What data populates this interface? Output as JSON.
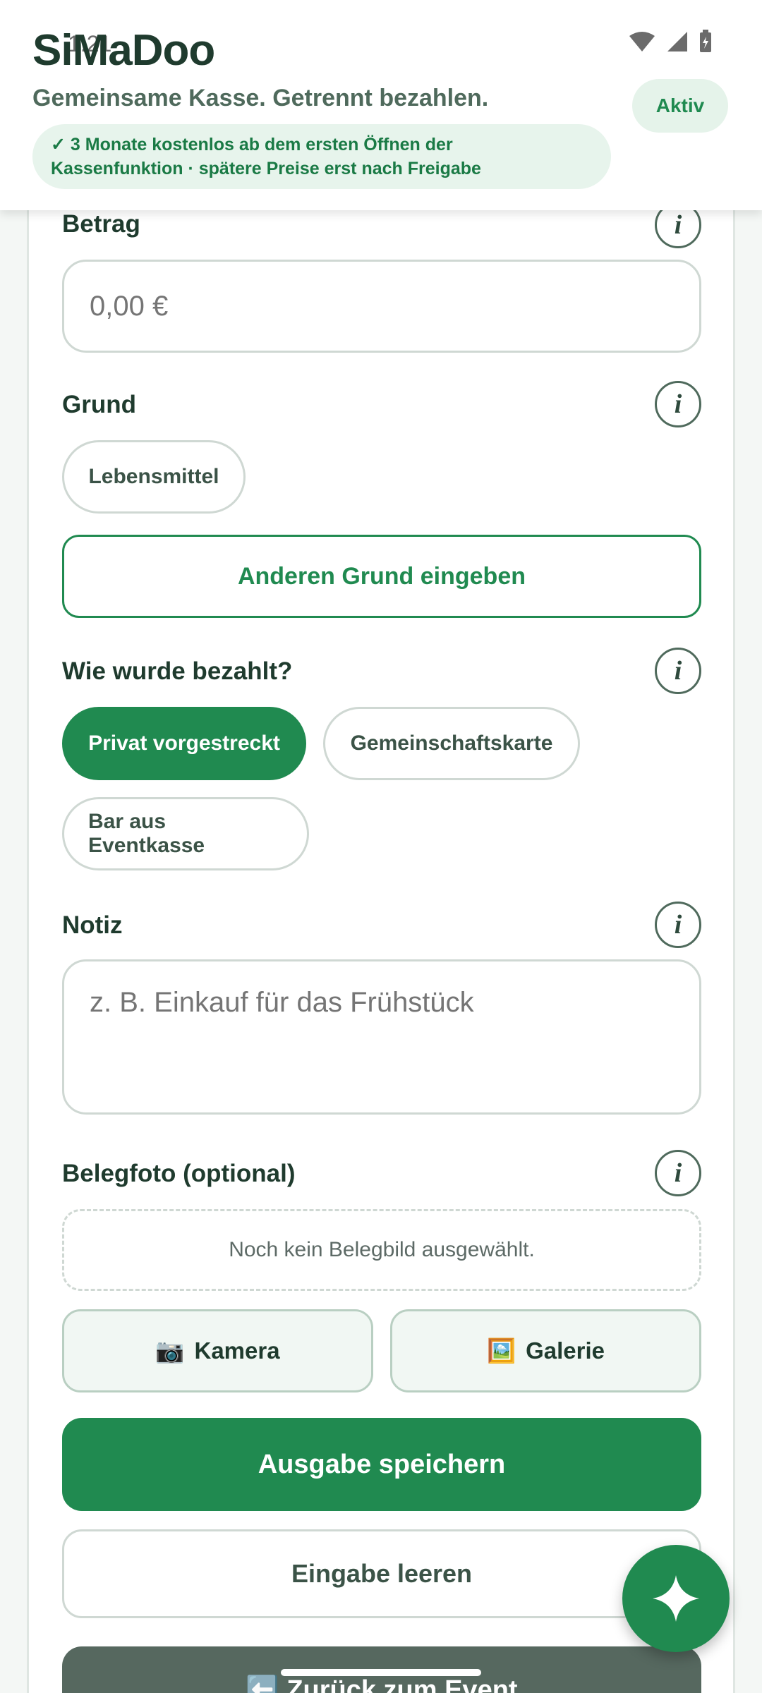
{
  "status_bar": {
    "time": "1:21"
  },
  "header": {
    "app_title": "SiMaDoo",
    "subtitle": "Gemeinsame Kasse. Getrennt bezahlen.",
    "status_badge": "Aktiv",
    "promo_line1": "✓ 3 Monate kostenlos ab dem ersten Öffnen der",
    "promo_line2": "Kassenfunktion · spätere Preise erst nach Freigabe"
  },
  "form": {
    "amount": {
      "label": "Betrag",
      "placeholder": "0,00 €"
    },
    "reason": {
      "label": "Grund",
      "chips": [
        "Lebensmittel"
      ],
      "other_button": "Anderen Grund eingeben"
    },
    "payment": {
      "label": "Wie wurde bezahlt?",
      "options": [
        "Privat vorgestreckt",
        "Gemeinschaftskarte",
        "Bar aus Eventkasse"
      ],
      "selected": "Privat vorgestreckt"
    },
    "note": {
      "label": "Notiz",
      "placeholder": "z. B. Einkauf für das Frühstück"
    },
    "receipt": {
      "label": "Belegfoto (optional)",
      "empty_text": "Noch kein Belegbild ausgewählt.",
      "camera_icon": "📷",
      "camera_label": "Kamera",
      "gallery_icon": "🖼️",
      "gallery_label": "Galerie"
    },
    "info_glyph": "i"
  },
  "actions": {
    "save": "Ausgabe speichern",
    "clear": "Eingabe leeren",
    "back": "⬅️ Zurück zum Event"
  },
  "colors": {
    "primary": "#208a50",
    "text_dark": "#1f3b2e",
    "badge_bg": "#e5f3ea",
    "back_button": "#56685f"
  },
  "icons": {
    "fab": "sparkle-icon",
    "info": "info-icon",
    "wifi": "wifi-icon",
    "signal": "signal-icon",
    "battery": "battery-icon"
  }
}
